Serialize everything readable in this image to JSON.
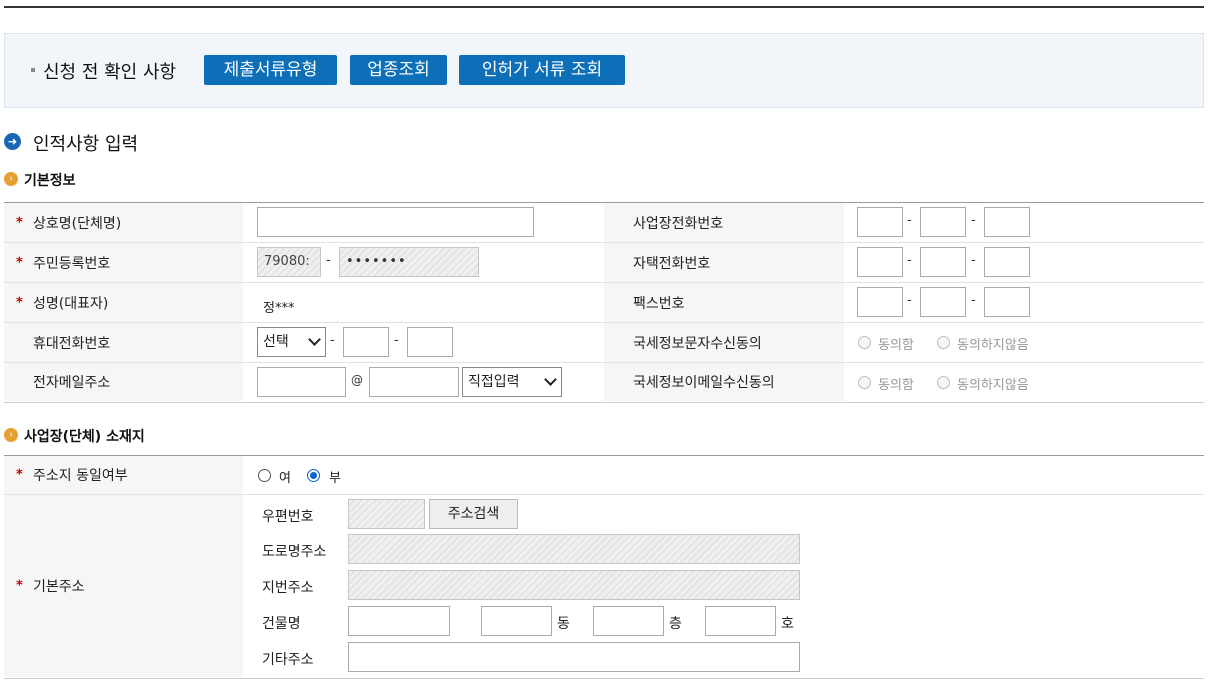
{
  "notice": {
    "title": "신청 전 확인 사항",
    "buttons": [
      "제출서류유형",
      "업종조회",
      "인허가 서류 조회"
    ]
  },
  "section_title": "인적사항 입력",
  "basic_info": {
    "title": "기본정보",
    "labels": {
      "company_name": "상호명(단체명)",
      "resident_number": "주민등록번호",
      "name": "성명(대표자)",
      "mobile": "휴대전화번호",
      "email": "전자메일주소",
      "business_phone": "사업장전화번호",
      "home_phone": "자택전화번호",
      "fax": "팩스번호",
      "sms_consent": "국세정보문자수신동의",
      "email_consent": "국세정보이메일수신동의"
    },
    "resident_front": "79080:",
    "resident_back": "•••••••",
    "name_value": "정***",
    "dash": "-",
    "mobile_select": "선택",
    "at_sign": "@",
    "email_domain_select": "직접입력",
    "consent_options": [
      "동의함",
      "동의하지않음"
    ]
  },
  "address": {
    "title": "사업장(단체) 소재지",
    "same_label": "주소지 동일여부",
    "same_options": [
      "여",
      "부"
    ],
    "same_selected": "부",
    "basic_label": "기본주소",
    "postcode_label": "우편번호",
    "search_button": "주소검색",
    "road_label": "도로명주소",
    "lot_label": "지번주소",
    "building_label": "건물명",
    "dong": "동",
    "floor": "층",
    "ho": "호",
    "other_label": "기타주소"
  }
}
